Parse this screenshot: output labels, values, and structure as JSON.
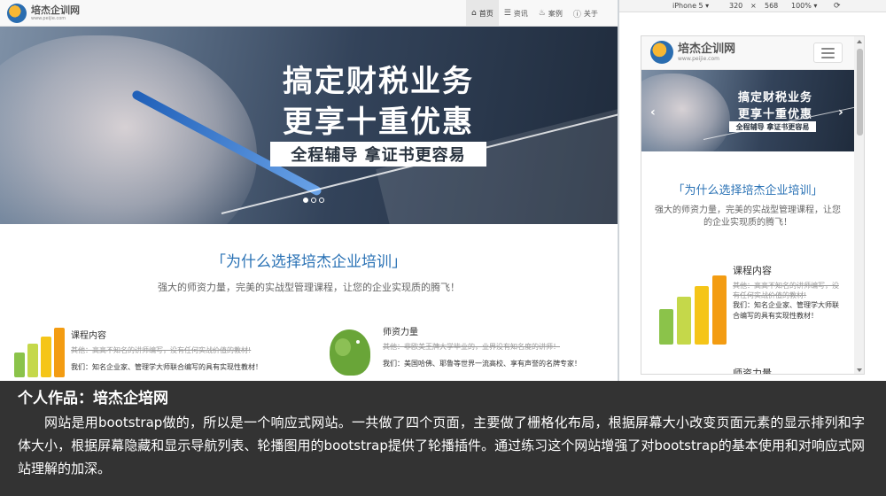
{
  "site": {
    "logo_title": "培杰企训网",
    "logo_url": "www.peijie.com"
  },
  "nav": {
    "items": [
      {
        "label": "首页",
        "icon": "home-icon",
        "active": true
      },
      {
        "label": "资讯",
        "icon": "list-icon",
        "active": false
      },
      {
        "label": "案例",
        "icon": "fire-icon",
        "active": false
      },
      {
        "label": "关于",
        "icon": "info-icon",
        "active": false
      }
    ]
  },
  "banner": {
    "line1": "搞定财税业务",
    "line2": "更享十重优惠",
    "tagline": "全程辅导 拿证书更容易",
    "slide_count": 3,
    "active_slide": 1
  },
  "why": {
    "title": "「为什么选择培杰企业培训」",
    "subtitle": "强大的师资力量，完美的实战型管理课程，让您的企业实现质的腾飞！"
  },
  "features": [
    {
      "title": "课程内容",
      "strike": "其他：高高不知名的讲师编写，没有任何实战价值的教材!",
      "desc": "我们：知名企业家、管理学大师联合编写的具有实现性教材！",
      "icon": "bar-chart-icon"
    },
    {
      "title": "师资力量",
      "strike": "其他：非欧美王牌大学毕业的，业界没有知名度的讲师！",
      "desc": "我们：美国哈佛、耶鲁等世界一流高校、享有声誉的名牌专家！",
      "icon": "elephant-icon"
    }
  ],
  "emulator": {
    "device": "iPhone 5 ▾",
    "width": "320",
    "separator": "×",
    "height": "568",
    "zoom": "100% ▾",
    "rotate_icon": "rotate-icon"
  },
  "mobile": {
    "why_subtitle": "强大的师资力量，完美的实战型管理课程，让您的企业实现质的腾飞！",
    "feature_title": "课程内容",
    "feature_strike": "其他：高高不知名的讲师编写，没有任何实战价值的教材!",
    "feature_desc": "我们：知名企业家、管理学大师联合编写的具有实现性教材！",
    "feature2_title": "师资力量"
  },
  "caption": {
    "title": "个人作品：培杰企培网",
    "body": "网站是用bootstrap做的，所以是一个响应式网站。一共做了四个页面，主要做了栅格化布局，根据屏幕大小改变页面元素的显示排列和字体大小，根据屏幕隐藏和显示导航列表、轮播图用的bootstrap提供了轮播插件。通过练习这个网站增强了对bootstrap的基本使用和对响应式网站理解的加深。"
  },
  "colors": {
    "accent_blue": "#2a72b5",
    "caption_bg": "#333333",
    "bar_green": "#8bc34a",
    "bar_yellow": "#f5c518",
    "bar_orange": "#f39c12",
    "elephant_green": "#69a538"
  }
}
